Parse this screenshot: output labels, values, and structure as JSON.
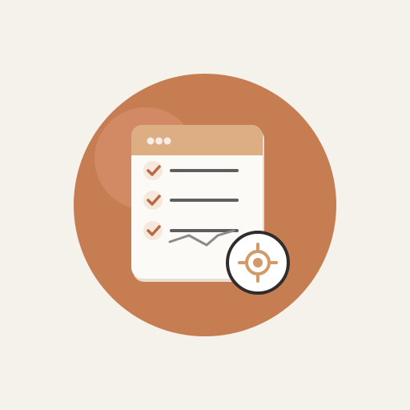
{
  "icon": {
    "subject": "checklist-window-with-crosshair",
    "colors": {
      "background": "#F5F1EB",
      "circle": "#C77D52",
      "circle_highlight": "#D89672",
      "window_body": "#FCFAF6",
      "window_shadow": "#E8DDD2",
      "title_bar": "#DDAE83",
      "title_dots": "#F6EEE4",
      "check_badge": "#F6E8DC",
      "check_mark": "#B86A44",
      "text_lines": "#5E5E5E",
      "scribble": "#8A8A8A",
      "badge_fill": "#FFFFFF",
      "badge_ring": "#2F2C2B",
      "target": "#D39A69"
    },
    "checklist": {
      "items": [
        {
          "checked": true
        },
        {
          "checked": true
        },
        {
          "checked": true
        }
      ]
    },
    "window_controls": [
      "dot",
      "dot",
      "dot"
    ],
    "badge": {
      "icon": "crosshair-icon"
    }
  }
}
